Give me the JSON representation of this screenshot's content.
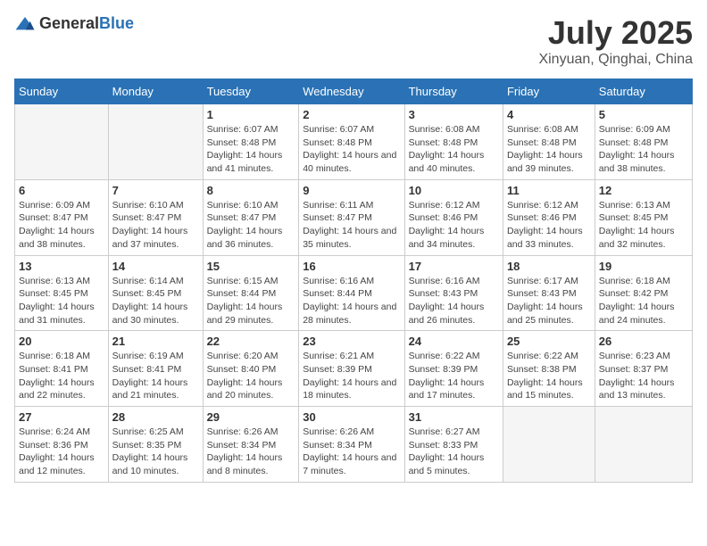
{
  "logo": {
    "text_general": "General",
    "text_blue": "Blue"
  },
  "title": "July 2025",
  "subtitle": "Xinyuan, Qinghai, China",
  "weekdays": [
    "Sunday",
    "Monday",
    "Tuesday",
    "Wednesday",
    "Thursday",
    "Friday",
    "Saturday"
  ],
  "weeks": [
    [
      {
        "day": "",
        "sunrise": "",
        "sunset": "",
        "daylight": "",
        "empty": true
      },
      {
        "day": "",
        "sunrise": "",
        "sunset": "",
        "daylight": "",
        "empty": true
      },
      {
        "day": "1",
        "sunrise": "Sunrise: 6:07 AM",
        "sunset": "Sunset: 8:48 PM",
        "daylight": "Daylight: 14 hours and 41 minutes.",
        "empty": false
      },
      {
        "day": "2",
        "sunrise": "Sunrise: 6:07 AM",
        "sunset": "Sunset: 8:48 PM",
        "daylight": "Daylight: 14 hours and 40 minutes.",
        "empty": false
      },
      {
        "day": "3",
        "sunrise": "Sunrise: 6:08 AM",
        "sunset": "Sunset: 8:48 PM",
        "daylight": "Daylight: 14 hours and 40 minutes.",
        "empty": false
      },
      {
        "day": "4",
        "sunrise": "Sunrise: 6:08 AM",
        "sunset": "Sunset: 8:48 PM",
        "daylight": "Daylight: 14 hours and 39 minutes.",
        "empty": false
      },
      {
        "day": "5",
        "sunrise": "Sunrise: 6:09 AM",
        "sunset": "Sunset: 8:48 PM",
        "daylight": "Daylight: 14 hours and 38 minutes.",
        "empty": false
      }
    ],
    [
      {
        "day": "6",
        "sunrise": "Sunrise: 6:09 AM",
        "sunset": "Sunset: 8:47 PM",
        "daylight": "Daylight: 14 hours and 38 minutes.",
        "empty": false
      },
      {
        "day": "7",
        "sunrise": "Sunrise: 6:10 AM",
        "sunset": "Sunset: 8:47 PM",
        "daylight": "Daylight: 14 hours and 37 minutes.",
        "empty": false
      },
      {
        "day": "8",
        "sunrise": "Sunrise: 6:10 AM",
        "sunset": "Sunset: 8:47 PM",
        "daylight": "Daylight: 14 hours and 36 minutes.",
        "empty": false
      },
      {
        "day": "9",
        "sunrise": "Sunrise: 6:11 AM",
        "sunset": "Sunset: 8:47 PM",
        "daylight": "Daylight: 14 hours and 35 minutes.",
        "empty": false
      },
      {
        "day": "10",
        "sunrise": "Sunrise: 6:12 AM",
        "sunset": "Sunset: 8:46 PM",
        "daylight": "Daylight: 14 hours and 34 minutes.",
        "empty": false
      },
      {
        "day": "11",
        "sunrise": "Sunrise: 6:12 AM",
        "sunset": "Sunset: 8:46 PM",
        "daylight": "Daylight: 14 hours and 33 minutes.",
        "empty": false
      },
      {
        "day": "12",
        "sunrise": "Sunrise: 6:13 AM",
        "sunset": "Sunset: 8:45 PM",
        "daylight": "Daylight: 14 hours and 32 minutes.",
        "empty": false
      }
    ],
    [
      {
        "day": "13",
        "sunrise": "Sunrise: 6:13 AM",
        "sunset": "Sunset: 8:45 PM",
        "daylight": "Daylight: 14 hours and 31 minutes.",
        "empty": false
      },
      {
        "day": "14",
        "sunrise": "Sunrise: 6:14 AM",
        "sunset": "Sunset: 8:45 PM",
        "daylight": "Daylight: 14 hours and 30 minutes.",
        "empty": false
      },
      {
        "day": "15",
        "sunrise": "Sunrise: 6:15 AM",
        "sunset": "Sunset: 8:44 PM",
        "daylight": "Daylight: 14 hours and 29 minutes.",
        "empty": false
      },
      {
        "day": "16",
        "sunrise": "Sunrise: 6:16 AM",
        "sunset": "Sunset: 8:44 PM",
        "daylight": "Daylight: 14 hours and 28 minutes.",
        "empty": false
      },
      {
        "day": "17",
        "sunrise": "Sunrise: 6:16 AM",
        "sunset": "Sunset: 8:43 PM",
        "daylight": "Daylight: 14 hours and 26 minutes.",
        "empty": false
      },
      {
        "day": "18",
        "sunrise": "Sunrise: 6:17 AM",
        "sunset": "Sunset: 8:43 PM",
        "daylight": "Daylight: 14 hours and 25 minutes.",
        "empty": false
      },
      {
        "day": "19",
        "sunrise": "Sunrise: 6:18 AM",
        "sunset": "Sunset: 8:42 PM",
        "daylight": "Daylight: 14 hours and 24 minutes.",
        "empty": false
      }
    ],
    [
      {
        "day": "20",
        "sunrise": "Sunrise: 6:18 AM",
        "sunset": "Sunset: 8:41 PM",
        "daylight": "Daylight: 14 hours and 22 minutes.",
        "empty": false
      },
      {
        "day": "21",
        "sunrise": "Sunrise: 6:19 AM",
        "sunset": "Sunset: 8:41 PM",
        "daylight": "Daylight: 14 hours and 21 minutes.",
        "empty": false
      },
      {
        "day": "22",
        "sunrise": "Sunrise: 6:20 AM",
        "sunset": "Sunset: 8:40 PM",
        "daylight": "Daylight: 14 hours and 20 minutes.",
        "empty": false
      },
      {
        "day": "23",
        "sunrise": "Sunrise: 6:21 AM",
        "sunset": "Sunset: 8:39 PM",
        "daylight": "Daylight: 14 hours and 18 minutes.",
        "empty": false
      },
      {
        "day": "24",
        "sunrise": "Sunrise: 6:22 AM",
        "sunset": "Sunset: 8:39 PM",
        "daylight": "Daylight: 14 hours and 17 minutes.",
        "empty": false
      },
      {
        "day": "25",
        "sunrise": "Sunrise: 6:22 AM",
        "sunset": "Sunset: 8:38 PM",
        "daylight": "Daylight: 14 hours and 15 minutes.",
        "empty": false
      },
      {
        "day": "26",
        "sunrise": "Sunrise: 6:23 AM",
        "sunset": "Sunset: 8:37 PM",
        "daylight": "Daylight: 14 hours and 13 minutes.",
        "empty": false
      }
    ],
    [
      {
        "day": "27",
        "sunrise": "Sunrise: 6:24 AM",
        "sunset": "Sunset: 8:36 PM",
        "daylight": "Daylight: 14 hours and 12 minutes.",
        "empty": false
      },
      {
        "day": "28",
        "sunrise": "Sunrise: 6:25 AM",
        "sunset": "Sunset: 8:35 PM",
        "daylight": "Daylight: 14 hours and 10 minutes.",
        "empty": false
      },
      {
        "day": "29",
        "sunrise": "Sunrise: 6:26 AM",
        "sunset": "Sunset: 8:34 PM",
        "daylight": "Daylight: 14 hours and 8 minutes.",
        "empty": false
      },
      {
        "day": "30",
        "sunrise": "Sunrise: 6:26 AM",
        "sunset": "Sunset: 8:34 PM",
        "daylight": "Daylight: 14 hours and 7 minutes.",
        "empty": false
      },
      {
        "day": "31",
        "sunrise": "Sunrise: 6:27 AM",
        "sunset": "Sunset: 8:33 PM",
        "daylight": "Daylight: 14 hours and 5 minutes.",
        "empty": false
      },
      {
        "day": "",
        "sunrise": "",
        "sunset": "",
        "daylight": "",
        "empty": true
      },
      {
        "day": "",
        "sunrise": "",
        "sunset": "",
        "daylight": "",
        "empty": true
      }
    ]
  ]
}
